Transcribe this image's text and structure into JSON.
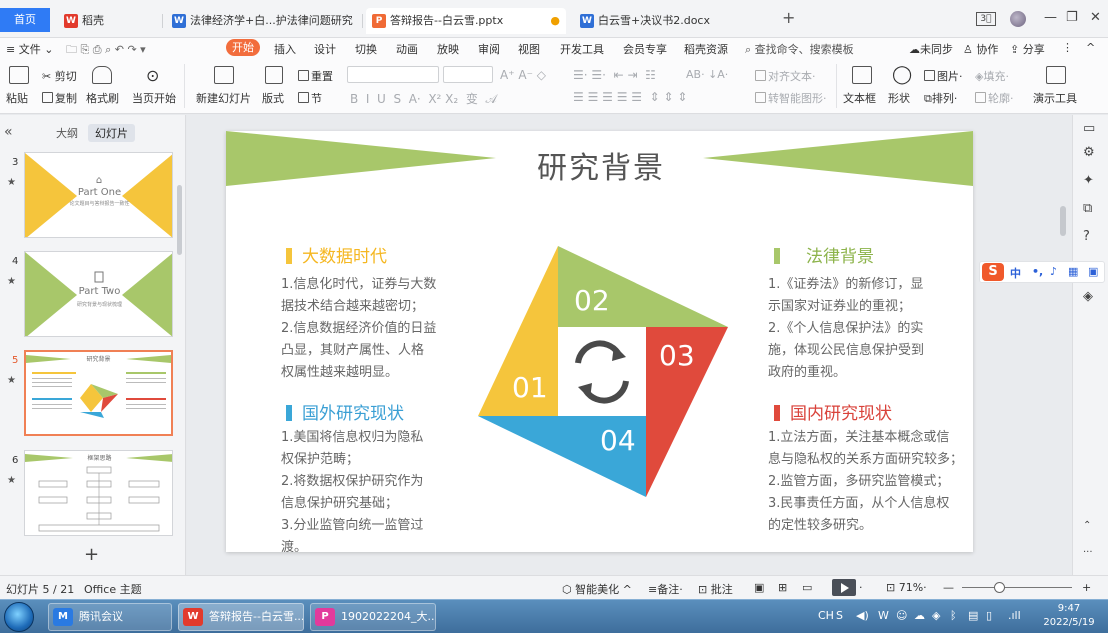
{
  "tabs": {
    "home": "首页",
    "items": [
      {
        "icon": "wps-icon",
        "label": "稻壳"
      },
      {
        "icon": "word-icon",
        "label": "法律经济学+白...护法律问题研究"
      },
      {
        "icon": "ppt-icon",
        "label": "答辩报告--白云雪.pptx"
      },
      {
        "icon": "word-icon",
        "label": "白云雪+决议书2.docx"
      }
    ]
  },
  "menu": {
    "file": "文件",
    "start": "开始",
    "items": [
      "插入",
      "设计",
      "切换",
      "动画",
      "放映",
      "审阅",
      "视图",
      "开发工具",
      "会员专享",
      "稻壳资源"
    ],
    "search": "查找命令、搜索模板",
    "sync": "未同步",
    "collab": "协作",
    "share": "分享"
  },
  "ribbon": {
    "paste": "粘贴",
    "cut": "剪切",
    "copy": "复制",
    "format_painter": "格式刷",
    "from_current": "当页开始",
    "new_slide": "新建幻灯片",
    "layout": "版式",
    "section": "节",
    "reset": "重置",
    "align_text": "对齐文本",
    "smartart": "转智能图形",
    "textbox": "文本框",
    "shape": "形状",
    "picture": "图片",
    "arrange": "排列",
    "fill": "填充",
    "outline": "轮廓",
    "presentation_tools": "演示工具"
  },
  "leftpanel": {
    "outline_tab": "大纲",
    "slides_tab": "幻灯片",
    "thumbs": [
      {
        "num": "3",
        "title": "Part One",
        "sub": "论文题目与答辩报告一致性"
      },
      {
        "num": "4",
        "title": "Part Two",
        "sub": "研究背景与现状梳理"
      },
      {
        "num": "5",
        "title": "研究背景"
      },
      {
        "num": "6",
        "title": "框架思路"
      }
    ]
  },
  "slide": {
    "title": "研究背景",
    "sections": {
      "bigdata": {
        "heading": "大数据时代",
        "lines": [
          "1.信息化时代，证券与大数",
          "据技术结合越来越密切；",
          "2.信息数据经济价值的日益",
          "凸显，其财产属性、人格",
          "权属性越来越明显。"
        ]
      },
      "foreign": {
        "heading": "国外研究现状",
        "lines": [
          "1.美国将信息权归为隐私",
          "权保护范畴；",
          "2.将数据权保护研究作为",
          "信息保护研究基础；",
          "3.分业监管向统一监管过",
          "渡。"
        ]
      },
      "legal": {
        "heading": "法律背景",
        "lines": [
          "1.《证券法》的新修订，显",
          "示国家对证券业的重视；",
          "2.《个人信息保护法》的实",
          "施，体现公民信息保护受到",
          "政府的重视。"
        ]
      },
      "domestic": {
        "heading": "国内研究现状",
        "lines": [
          "1.立法方面，关注基本概念或信",
          "息与隐私权的关系方面研究较多；",
          "2.监管方面，多研究监管模式；",
          "3.民事责任方面，从个人信息权",
          "的定性较多研究。"
        ]
      }
    },
    "diagram_labels": [
      "01",
      "02",
      "03",
      "04"
    ],
    "colors": {
      "green": "#a8c76a",
      "yellow": "#f5c53c",
      "red": "#e04a3c",
      "blue": "#3aa7d8"
    }
  },
  "ime": {
    "lang": "中"
  },
  "status": {
    "slide_info": "幻灯片 5 / 21",
    "theme": "Office 主题",
    "beautify": "智能美化",
    "notes": "备注",
    "comments": "批注",
    "zoom": "71%"
  },
  "taskbar": {
    "items": [
      {
        "icon": "meeting-icon",
        "label": "腾讯会议"
      },
      {
        "icon": "wps-icon",
        "label": "答辩报告--白云雪..."
      },
      {
        "icon": "pdf-icon",
        "label": "1902022204_大..."
      }
    ],
    "tray_ch": "CH",
    "time": "9:47",
    "date": "2022/5/19"
  }
}
